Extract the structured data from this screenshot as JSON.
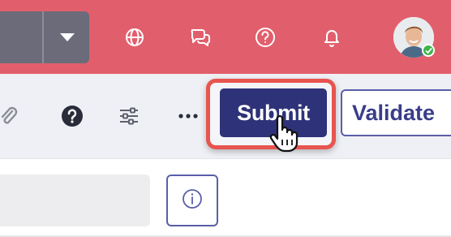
{
  "colors": {
    "topbar": "#e15f6c",
    "toolbar": "#eef0f5",
    "submit_bg": "#2e3278",
    "validate_border": "#5b5ea8",
    "highlight": "#e8544f",
    "status_online": "#3bb54a"
  },
  "topbar": {
    "dropdown_icon": "caret-down-icon",
    "icons": [
      "globe-icon",
      "chat-bubbles-icon",
      "help-circle-icon",
      "bell-icon"
    ],
    "avatar_status": "online"
  },
  "toolbar": {
    "icons": [
      "paperclip-icon",
      "question-icon",
      "sliders-icon",
      "more-icon"
    ],
    "submit_label": "Submit",
    "validate_label": "Validate",
    "cursor": "hand-pointer-cursor"
  },
  "content": {
    "search_value": "",
    "info_icon": "info-icon"
  }
}
